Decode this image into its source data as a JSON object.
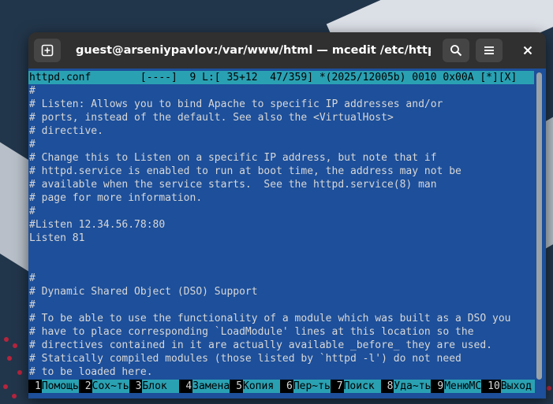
{
  "window": {
    "title": "guest@arseniypavlov:/var/www/html — mcedit /etc/httpd/conf…"
  },
  "icons": {
    "new_tab": "new-tab-icon",
    "search": "search-icon",
    "menu": "hamburger-menu-icon",
    "close": "close-icon"
  },
  "editor": {
    "status_line": "httpd.conf        [----]  9 L:[ 35+12  47/359] *(2025/12005b) 0010 0x00A [*][X]",
    "lines": [
      "#",
      "# Listen: Allows you to bind Apache to specific IP addresses and/or",
      "# ports, instead of the default. See also the <VirtualHost>",
      "# directive.",
      "#",
      "# Change this to Listen on a specific IP address, but note that if",
      "# httpd.service is enabled to run at boot time, the address may not be",
      "# available when the service starts.  See the httpd.service(8) man",
      "# page for more information.",
      "#",
      "#Listen 12.34.56.78:80",
      "Listen 81",
      "",
      "",
      "#",
      "# Dynamic Shared Object (DSO) Support",
      "#",
      "# To be able to use the functionality of a module which was built as a DSO you",
      "# have to place corresponding `LoadModule' lines at this location so the",
      "# directives contained in it are actually available _before_ they are used.",
      "# Statically compiled modules (those listed by `httpd -l') do not need",
      "# to be loaded here."
    ]
  },
  "fkeys": [
    {
      "num": "1",
      "label": "Помощь"
    },
    {
      "num": "2",
      "label": "Сох~ть"
    },
    {
      "num": "3",
      "label": "Блок  "
    },
    {
      "num": "4",
      "label": "Замена"
    },
    {
      "num": "5",
      "label": "Копия "
    },
    {
      "num": "6",
      "label": "Пер~ть"
    },
    {
      "num": "7",
      "label": "Поиск "
    },
    {
      "num": "8",
      "label": "Уда~ть"
    },
    {
      "num": "9",
      "label": "МенюMC"
    },
    {
      "num": "10",
      "label": "Выход "
    }
  ],
  "colors": {
    "editor_bg": "#1d4f9a",
    "status_bg": "#2aa1b3",
    "titlebar_bg": "#303030"
  }
}
